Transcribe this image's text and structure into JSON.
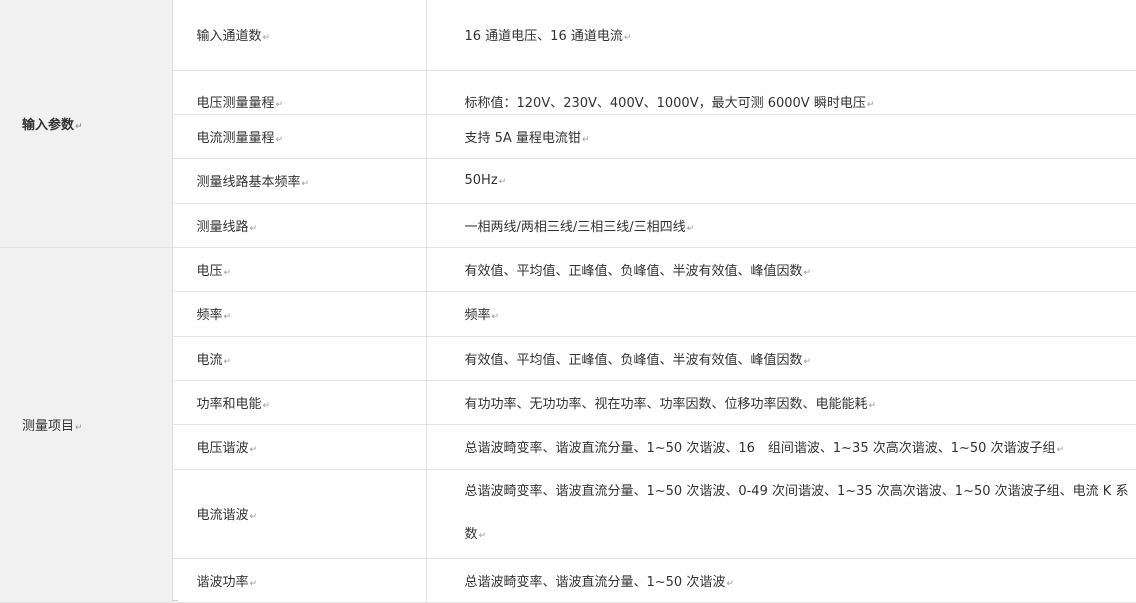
{
  "table": {
    "groups": [
      {
        "label": "输入参数",
        "rows": [
          {
            "name": "输入通道数",
            "value": "16 通道电压、16 通道电流"
          },
          {
            "name": "电压测量量程",
            "value": "标称值：120V、230V、400V、1000V，最大可测 6000V 瞬时电压"
          },
          {
            "name": "电流测量量程",
            "value": "支持 5A 量程电流钳"
          },
          {
            "name": "测量线路基本频率",
            "value": "50Hz"
          },
          {
            "name": "测量线路",
            "value": "一相两线/两相三线/三相三线/三相四线"
          }
        ]
      },
      {
        "label": "测量项目",
        "rows": [
          {
            "name": "电压",
            "value": "有效值、平均值、正峰值、负峰值、半波有效值、峰值因数"
          },
          {
            "name": "频率",
            "value": "频率"
          },
          {
            "name": "电流",
            "value": "有效值、平均值、正峰值、负峰值、半波有效值、峰值因数"
          },
          {
            "name": "功率和电能",
            "value": "有功功率、无功功率、视在功率、功率因数、位移功率因数、电能能耗"
          },
          {
            "name": "电压谐波",
            "value": "总谐波畸变率、谐波直流分量、1~50 次谐波、16　组间谐波、1~35 次高次谐波、1~50 次谐波子组"
          },
          {
            "name": "电流谐波",
            "value": "总谐波畸变率、谐波直流分量、1~50 次谐波、0-49 次间谐波、1~35 次高次谐波、1~50 次谐波子组、电流 K 系数"
          },
          {
            "name": "谐波功率",
            "value": "总谐波畸变率、谐波直流分量、1~50 次谐波"
          }
        ]
      }
    ],
    "paragraph_mark": "↵"
  }
}
